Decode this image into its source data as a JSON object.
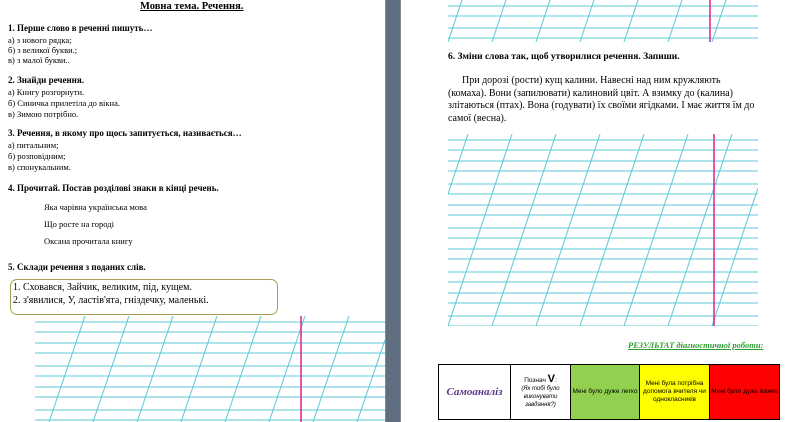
{
  "left": {
    "title": "Мовна тема.  Речення.",
    "q1": {
      "heading": "1. Перше слово в реченні пишуть…",
      "options": [
        "а) з нового рядка;",
        "б) з великої букви.;",
        "в) з малої букви.."
      ]
    },
    "q2": {
      "heading": "2. Знайди речення.",
      "options": [
        "а) Книгу розгорнути.",
        "б) Синичка прилетіла до вікна.",
        "в) Зимою потрібно."
      ]
    },
    "q3": {
      "heading": "3. Речення,  в якому  про щось запитується, називається…",
      "options": [
        "а) питальним;",
        "б) розповідним;",
        "в) спонукальним."
      ]
    },
    "q4": {
      "heading": "4. Прочитай. Постав розділові знаки в кінці речень.",
      "sentences": [
        "Яка чарівна українська мова",
        "Що росте на городі",
        "Оксана прочитала книгу"
      ]
    },
    "q5": {
      "heading": "5. Склади речення  з поданих слів.",
      "items": [
        "1.  Сховався, Зайчик, великим, під, кущем.",
        "2.  з'явилися, У, ластів'ята, гніздечку, маленькі."
      ]
    }
  },
  "right": {
    "q6_heading": "6. Зміни слова так, щоб утворилися речення. Запиши.",
    "q6_text": "При дорозі (рости) кущ калини. Навесні над ним кружляють (комаха). Вони (запилювати) калиновий цвіт. А взимку до (калина) злітаються (птах). Вона (годувати) їх своїми ягідками. І має життя їм до самої (весна).",
    "result_label": "РЕЗУЛЬТАТ діагностичної роботи:",
    "table": {
      "self_assessment": "Самоаналіз",
      "mark_prefix": "Познач",
      "mark_symbol": "V",
      "mark_question": "(Як тобі було виконувати завдання?)",
      "easy": "Мені було дуже легко",
      "help": "Мені була потрібна допомога вчителя чи однокласників",
      "hard": "Мені було дуже важко"
    }
  },
  "colors": {
    "guide_lines": "#5cc8d8",
    "margin_line": "#e0208a",
    "box_border": "#a8a250",
    "green": "#92d050",
    "yellow": "#ffff00",
    "red": "#ff0000"
  }
}
